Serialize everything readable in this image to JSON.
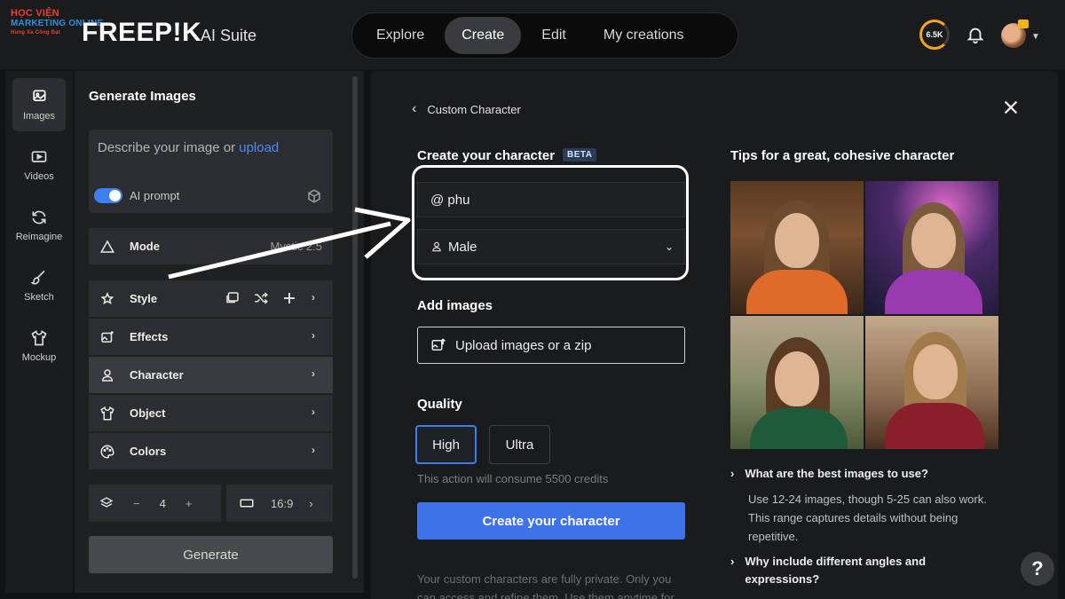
{
  "watermark": {
    "line1": "HỌC VIỆN",
    "line2": "MARKETING ONLINE",
    "line3": "Hùng Xa Công Đạt"
  },
  "brand": {
    "wordmark": "FREEP!K",
    "suite": "AI Suite"
  },
  "nav": {
    "tabs": [
      "Explore",
      "Create",
      "Edit",
      "My creations"
    ],
    "active": "Create"
  },
  "account": {
    "credits": "6.5K"
  },
  "rail": {
    "items": [
      "Images",
      "Videos",
      "Reimagine",
      "Sketch",
      "Mockup"
    ]
  },
  "generate": {
    "title": "Generate Images",
    "prompt_placeholder": "Describe your image or ",
    "prompt_link": "upload",
    "ai_prompt_label": "AI prompt",
    "ai_prompt_on": true,
    "mode_label": "Mode",
    "mode_value": "Mystic 2.5",
    "options": [
      "Style",
      "Effects",
      "Character",
      "Object",
      "Colors"
    ],
    "selected_option": "Character",
    "count": "4",
    "minus": "−",
    "plus": "+",
    "ratio": "16:9",
    "generate_label": "Generate"
  },
  "character": {
    "back_label": "Custom Character",
    "create_title": "Create your character",
    "beta": "BETA",
    "name_value": "@ phu",
    "gender_value": "Male",
    "add_images_title": "Add images",
    "upload_label": "Upload images or a zip",
    "quality_title": "Quality",
    "quality_options": [
      "High",
      "Ultra"
    ],
    "quality_selected": "High",
    "consume_note": "This action will consume 5500 credits",
    "create_button": "Create your character",
    "private_note": "Your custom characters are fully private. Only you can access and refine them. Use them anytime for"
  },
  "tips": {
    "title": "Tips for a great, cohesive character",
    "faq": [
      {
        "q": "What are the best images to use?",
        "a": "Use 12-24 images, though 5-25 can also work. This range captures details without being repetitive."
      },
      {
        "q": "Why include different angles and expressions?",
        "a": ""
      }
    ]
  },
  "help": {
    "label": "?"
  },
  "colors": {
    "accent": "#3d72e8",
    "credits_ring": "#f2a81b",
    "background": "#121314"
  }
}
